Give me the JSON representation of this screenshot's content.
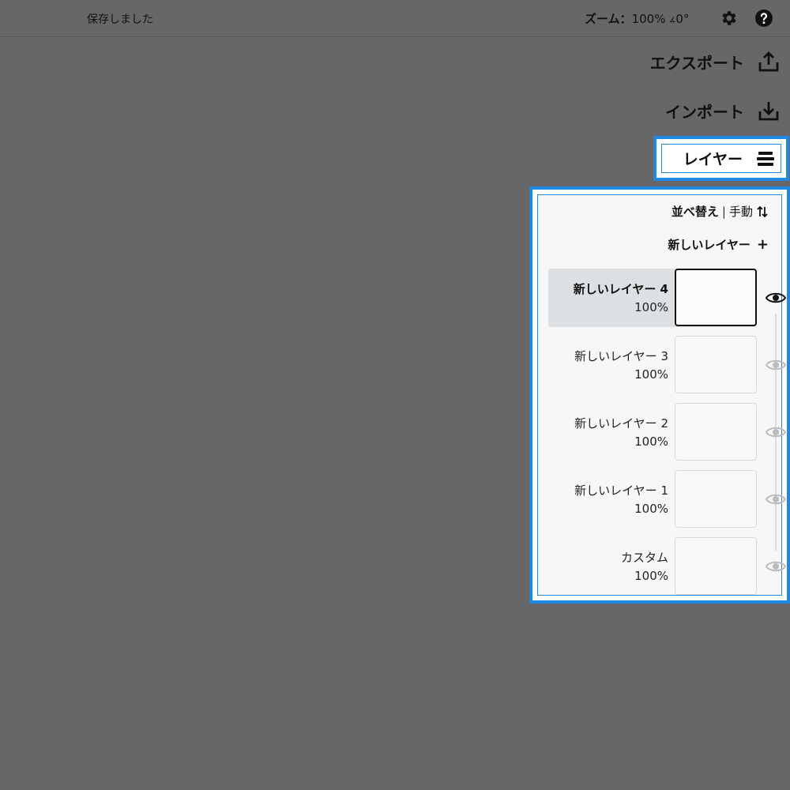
{
  "status": {
    "saved": "保存しました"
  },
  "zoom": {
    "label": "ズーム：",
    "value": "100%",
    "rotation_symbol": "∡",
    "rotation": "0°"
  },
  "toolbar": {
    "settings_icon": "gear-icon",
    "help_icon": "help-icon"
  },
  "actions": {
    "export_label": "エクスポート",
    "import_label": "インポート",
    "layers_label": "レイヤー"
  },
  "layers_panel": {
    "sort_label": "並べ替え",
    "sort_separator": "|",
    "sort_mode": "手動",
    "new_layer_label": "新しいレイヤー",
    "new_layer_plus": "+",
    "layers": [
      {
        "name": "新しいレイヤー 4",
        "opacity": "100%",
        "visible": true,
        "selected": true
      },
      {
        "name": "新しいレイヤー 3",
        "opacity": "100%",
        "visible": false,
        "selected": false
      },
      {
        "name": "新しいレイヤー 2",
        "opacity": "100%",
        "visible": false,
        "selected": false
      },
      {
        "name": "新しいレイヤー 1",
        "opacity": "100%",
        "visible": false,
        "selected": false
      },
      {
        "name": "カスタム",
        "opacity": "100%",
        "visible": false,
        "selected": false
      }
    ]
  },
  "colors": {
    "accent": "#1e88e5",
    "canvas": "#676767"
  }
}
